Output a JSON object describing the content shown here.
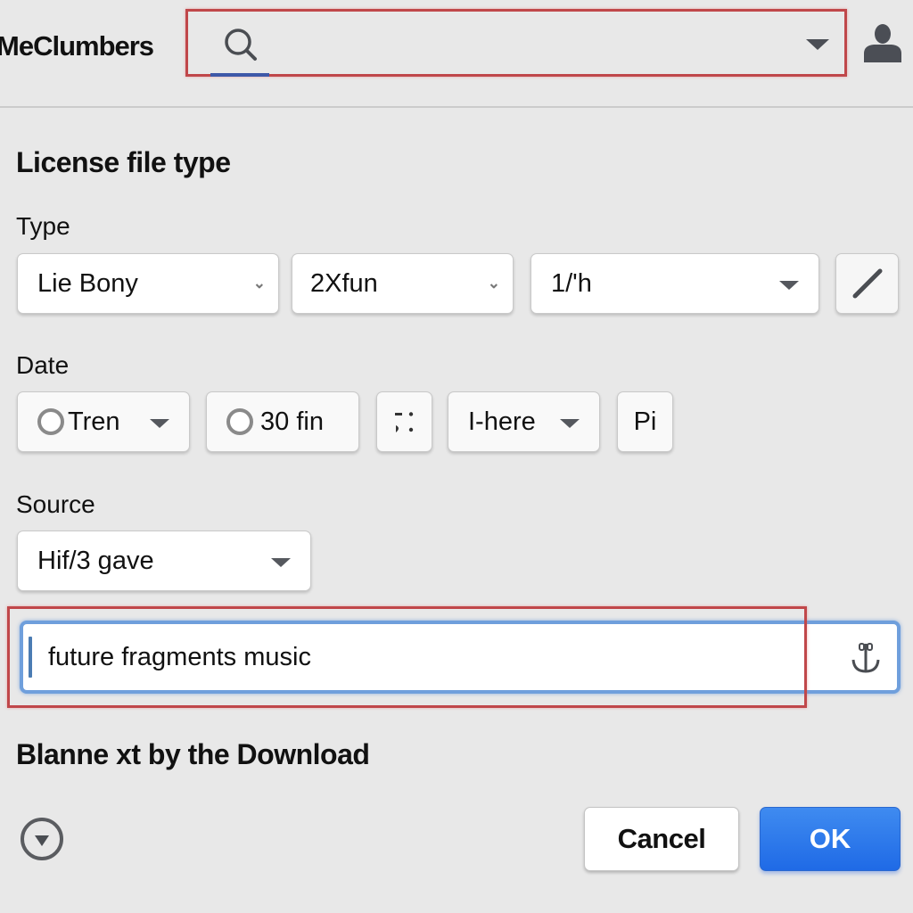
{
  "header": {
    "app_title": "MeClumbers",
    "search": {
      "value": "",
      "placeholder": ""
    },
    "icons": {
      "search": "search-icon",
      "dropdown": "caret-down-icon",
      "account": "user-icon"
    }
  },
  "form": {
    "title": "License file type",
    "type": {
      "label": "Type",
      "selects": [
        {
          "value": "Lie Bony"
        },
        {
          "value": "2Xfun"
        },
        {
          "value": "1/'h"
        }
      ],
      "edit_button_icon": "pencil-icon"
    },
    "date": {
      "label": "Date",
      "options": [
        {
          "label": "Tren",
          "kind": "radio-dropdown",
          "selected": false
        },
        {
          "label": "30 fin",
          "kind": "radio",
          "selected": false
        },
        {
          "label": "",
          "kind": "icon-button",
          "icon": "dots-icon"
        },
        {
          "label": "I-here",
          "kind": "dropdown"
        },
        {
          "label": "Pi",
          "kind": "button"
        }
      ]
    },
    "source": {
      "label": "Source",
      "value": "Hif/3 gave"
    },
    "query": {
      "value": "future fragments music",
      "icon": "anchor-icon"
    },
    "subheading": "Blanne xt by the Download"
  },
  "footer": {
    "expand_icon": "circle-chevron-down-icon",
    "cancel_label": "Cancel",
    "ok_label": "OK"
  },
  "colors": {
    "background": "#e8e8e8",
    "highlight_frame": "#c0474a",
    "focus_ring": "#6f9fdc",
    "primary": "#2a74ea"
  }
}
